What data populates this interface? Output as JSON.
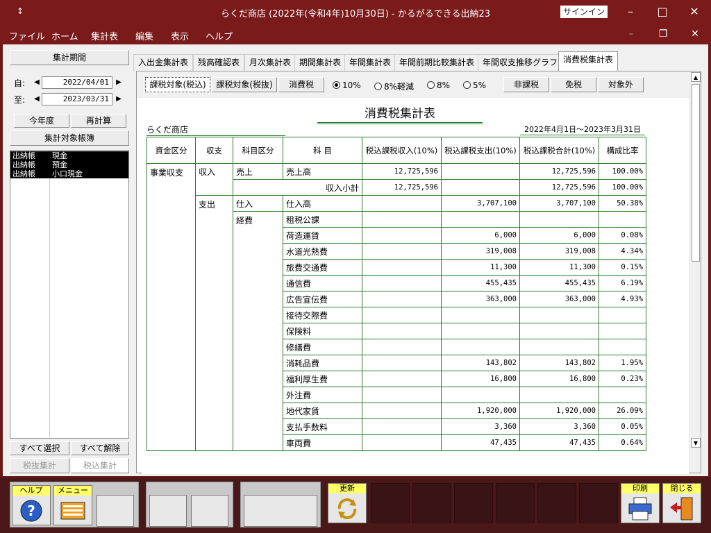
{
  "window": {
    "title": "らくだ商店 (2022年(令和4年)10月30日)  -  かるがるできる出納23",
    "signin": "サインイン"
  },
  "menu": [
    "ファイル",
    "ホーム",
    "集計表",
    "編集",
    "表示",
    "ヘルプ"
  ],
  "left": {
    "period_header": "集計期間",
    "from_label": "自:",
    "from_date": "2022/04/01",
    "to_label": "至:",
    "to_date": "2023/03/31",
    "this_year": "今年度",
    "recalc": "再計算",
    "books_header": "集計対象帳簿",
    "books": [
      {
        "type": "出納帳",
        "name": "現金"
      },
      {
        "type": "出納帳",
        "name": "預金"
      },
      {
        "type": "出納帳",
        "name": "小口現金"
      }
    ],
    "select_all": "すべて選択",
    "deselect_all": "すべて解除",
    "tax_excl": "税抜集計",
    "tax_incl": "税込集計"
  },
  "tabs": [
    "入出金集計表",
    "残高確認表",
    "月次集計表",
    "期間集計表",
    "年間集計表",
    "年間前期比較集計表",
    "年間収支推移グラフ",
    "消費税集計表"
  ],
  "toolbar": {
    "btn_incl": "課税対象(税込)",
    "btn_excl": "課税対象(税抜)",
    "btn_tax": "消費税",
    "radios": [
      "10%",
      "8%軽減",
      "8%",
      "5%"
    ],
    "btn_nontax": "非課税",
    "btn_exempt": "免税",
    "btn_outside": "対象外"
  },
  "report": {
    "title": "消費税集計表",
    "company": "らくだ商店",
    "period": "2022年4月1日～2023年3月31日",
    "headers": [
      "資金区分",
      "収支",
      "科目区分",
      "科 目",
      "税込課税収入(10%)",
      "税込課税支出(10%)",
      "税込課税合計(10%)",
      "構成比率"
    ],
    "fund": "事業収支",
    "income_label": "収入",
    "income_cat": "売上",
    "income_item": "売上高",
    "income_value": "12,725,596",
    "income_total": "12,725,596",
    "income_ratio": "100.00%",
    "subtotal_label": "収入小計",
    "subtotal_value": "12,725,596",
    "subtotal_total": "12,725,596",
    "subtotal_ratio": "100.00%",
    "expense_label": "支出",
    "purchase_cat": "仕入",
    "purchase_item": "仕入高",
    "purchase_value": "3,707,100",
    "purchase_total": "3,707,100",
    "purchase_ratio": "50.38%",
    "expense_cat": "経費",
    "expense_rows": [
      {
        "item": "租税公課",
        "value": "",
        "total": "",
        "ratio": ""
      },
      {
        "item": "荷造運賃",
        "value": "6,000",
        "total": "6,000",
        "ratio": "0.08%"
      },
      {
        "item": "水道光熱費",
        "value": "319,008",
        "total": "319,008",
        "ratio": "4.34%"
      },
      {
        "item": "旅費交通費",
        "value": "11,300",
        "total": "11,300",
        "ratio": "0.15%"
      },
      {
        "item": "通信費",
        "value": "455,435",
        "total": "455,435",
        "ratio": "6.19%"
      },
      {
        "item": "広告宣伝費",
        "value": "363,000",
        "total": "363,000",
        "ratio": "4.93%"
      },
      {
        "item": "接待交際費",
        "value": "",
        "total": "",
        "ratio": ""
      },
      {
        "item": "保険料",
        "value": "",
        "total": "",
        "ratio": ""
      },
      {
        "item": "修繕費",
        "value": "",
        "total": "",
        "ratio": ""
      },
      {
        "item": "消耗品費",
        "value": "143,802",
        "total": "143,802",
        "ratio": "1.95%"
      },
      {
        "item": "福利厚生費",
        "value": "16,800",
        "total": "16,800",
        "ratio": "0.23%"
      },
      {
        "item": "外注費",
        "value": "",
        "total": "",
        "ratio": ""
      },
      {
        "item": "地代家賃",
        "value": "1,920,000",
        "total": "1,920,000",
        "ratio": "26.09%"
      },
      {
        "item": "支払手数料",
        "value": "3,360",
        "total": "3,360",
        "ratio": "0.05%"
      },
      {
        "item": "車両費",
        "value": "47,435",
        "total": "47,435",
        "ratio": "0.64%"
      }
    ]
  },
  "footer": {
    "help": "ヘルプ",
    "menu": "メニュー",
    "refresh": "更新",
    "print": "印刷",
    "close": "閉じる"
  }
}
